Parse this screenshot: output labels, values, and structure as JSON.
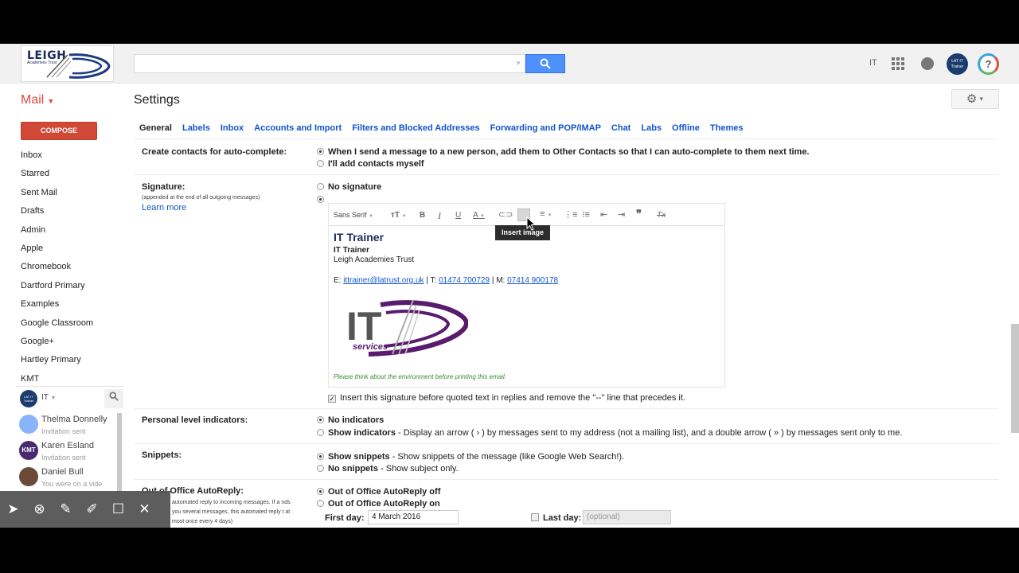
{
  "topbar": {
    "logo_text": "LEIGH",
    "logo_sub": "Academies Trust",
    "user_initials": "IT",
    "avatar_text": "LAT IT Trainer",
    "help_label": "?"
  },
  "header": {
    "mail_label": "Mail",
    "settings_title": "Settings",
    "gear": "⚙"
  },
  "compose_label": "COMPOSE",
  "nav": {
    "items": [
      "Inbox",
      "Starred",
      "Sent Mail",
      "Drafts",
      "Admin",
      "Apple",
      "Chromebook",
      "Dartford Primary",
      "Examples",
      "Google Classroom",
      "Google+",
      "Hartley Primary",
      "KMT"
    ]
  },
  "hangouts": {
    "self_avatar": "LAT IT Trainer",
    "self_name": "IT",
    "contacts": [
      {
        "initials": "",
        "name": "Thelma Donnelly",
        "status": "Invitation sent",
        "color": "#8ab4f8"
      },
      {
        "initials": "KMT",
        "name": "Karen Esland",
        "status": "Invitation sent",
        "color": "#4a2a6e"
      },
      {
        "initials": "",
        "name": "Daniel Bull",
        "status": "You were on a vide",
        "color": "#6b4a3a"
      }
    ]
  },
  "tabs": [
    "General",
    "Labels",
    "Inbox",
    "Accounts and Import",
    "Filters and Blocked Addresses",
    "Forwarding and POP/IMAP",
    "Chat",
    "Labs",
    "Offline",
    "Themes"
  ],
  "autocomplete": {
    "label": "Create contacts for auto-complete:",
    "opt1": "When I send a message to a new person, add them to Other Contacts so that I can auto-complete to them next time.",
    "opt2": "I'll add contacts myself"
  },
  "signature": {
    "label": "Signature:",
    "note": "(appended at the end of all outgoing messages)",
    "learn_more": "Learn more",
    "no_sig": "No signature",
    "font": "Sans Serif",
    "tooltip": "Insert image",
    "name": "IT Trainer",
    "role": "IT Trainer",
    "org": "Leigh Academies Trust",
    "contact_e_prefix": "E: ",
    "email": "ittrainer@latrust.org.uk",
    "contact_t_prefix": " | T: ",
    "phone": "01474 700729",
    "contact_m_prefix": " | M: ",
    "mobile": "07414 900178",
    "logo_text": "IT",
    "logo_sub": "services",
    "env_note": "Please think about the environment before printing this email.",
    "insert_before": "Insert this signature before quoted text in replies and remove the \"--\" line that precedes it."
  },
  "personal": {
    "label": "Personal level indicators:",
    "opt1": "No indicators",
    "opt2_bold": "Show indicators",
    "opt2_rest": " - Display an arrow ( › ) by messages sent to my address (not a mailing list), and a double arrow ( » ) by messages sent only to me."
  },
  "snippets": {
    "label": "Snippets:",
    "opt1_bold": "Show snippets",
    "opt1_rest": " - Show snippets of the message (like Google Web Search!).",
    "opt2_bold": "No snippets",
    "opt2_rest": " - Show subject only."
  },
  "ooo": {
    "label": "Out of Office AutoReply:",
    "note": "automated reply to incoming messages. If a nds you several messages, this automated reply t at most once every 4 days)",
    "opt1": "Out of Office AutoReply off",
    "opt2": "Out of Office AutoReply on",
    "first_day_label": "First day:",
    "first_day_value": "4 March 2016",
    "last_day_label": "Last day:",
    "last_day_placeholder": "(optional)"
  },
  "colors": {
    "accent_red": "#dd4b39",
    "link_blue": "#1155cc",
    "search_blue": "#4d90fe"
  }
}
